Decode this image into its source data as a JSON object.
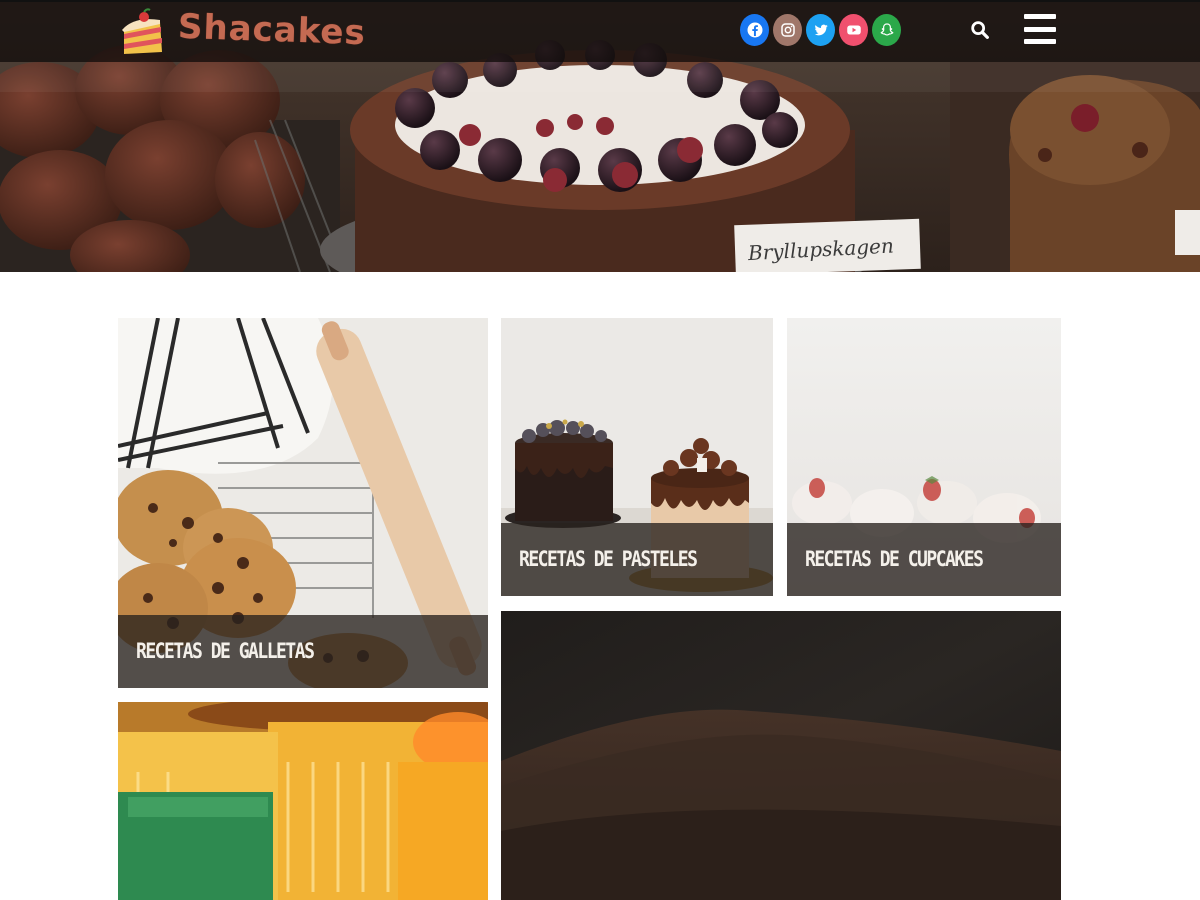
{
  "header": {
    "logo_text": "Shacakes",
    "social": [
      {
        "name": "facebook",
        "color": "#1877f2"
      },
      {
        "name": "instagram",
        "color": "#a0776a"
      },
      {
        "name": "twitter",
        "color": "#1da1f2"
      },
      {
        "name": "youtube",
        "color": "#f0506e"
      },
      {
        "name": "snapchat",
        "color": "#2ba84a"
      }
    ]
  },
  "hero": {
    "sign_text": "Bryllupskagen"
  },
  "categories": [
    {
      "label": "RECETAS DE GALLETAS"
    },
    {
      "label": "RECETAS DE PASTELES"
    },
    {
      "label": "RECETAS DE CUPCAKES"
    }
  ],
  "colors": {
    "caption_bg": "#28211e",
    "caption_text": "#f4f0ea",
    "logo": "#c46a52"
  }
}
